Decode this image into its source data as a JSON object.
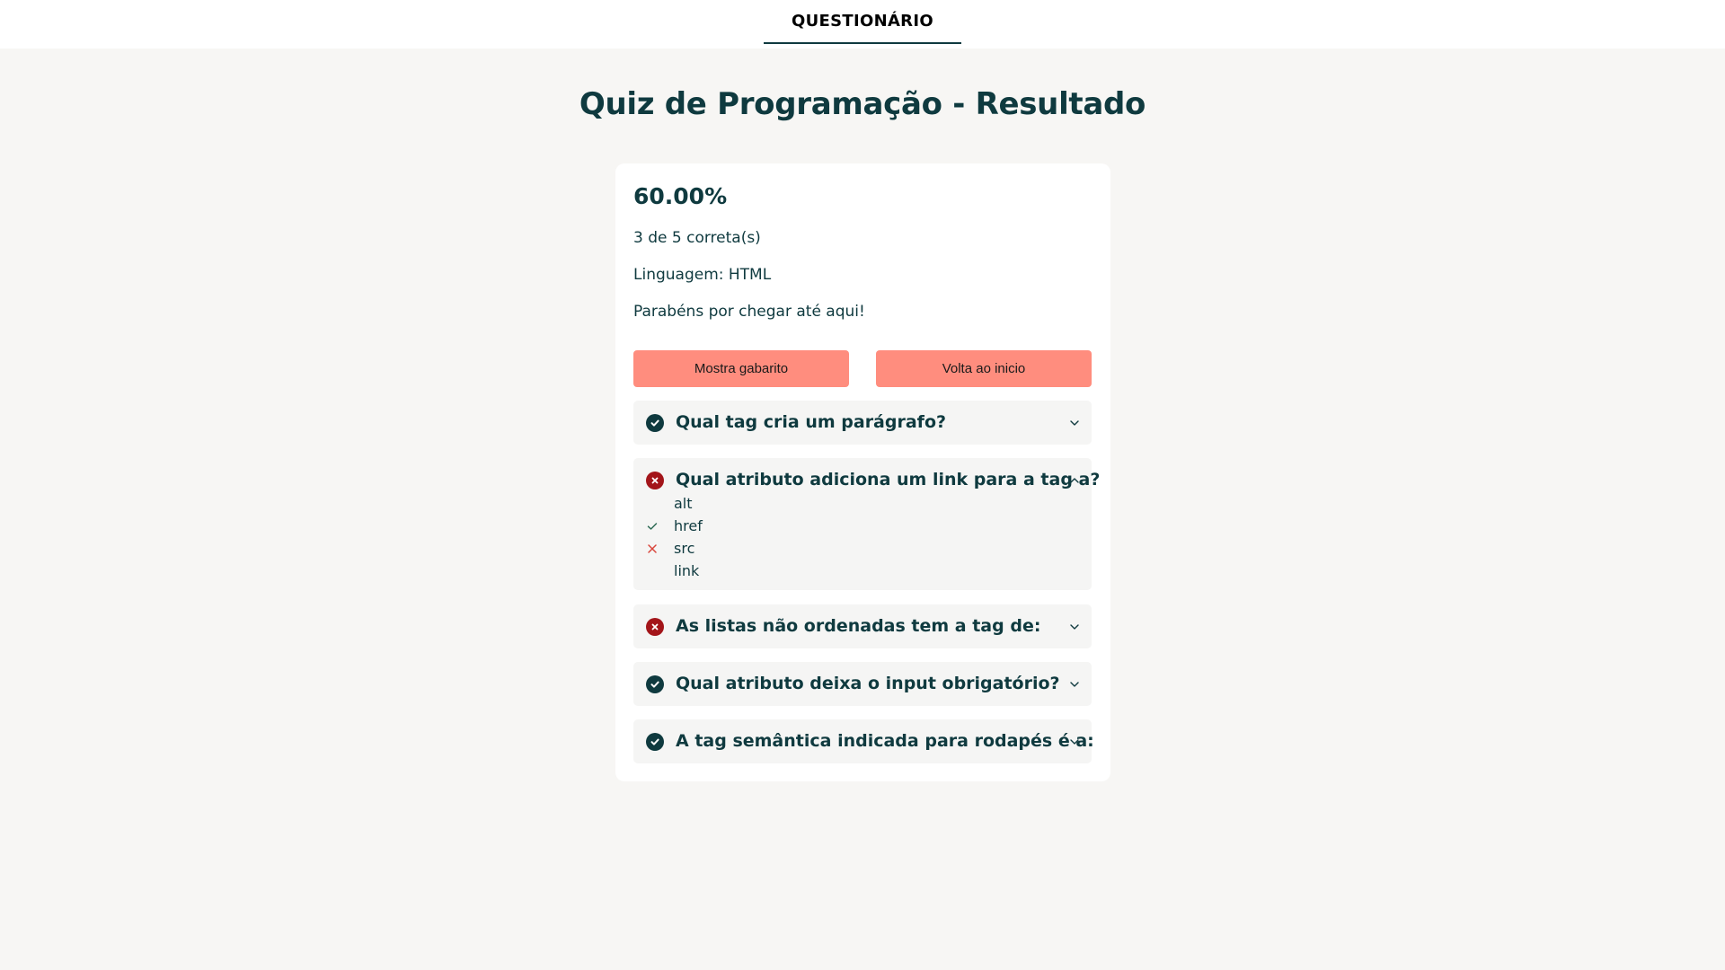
{
  "nav": {
    "tab_label": "QUESTIONÁRIO"
  },
  "page": {
    "title": "Quiz de Programação - Resultado"
  },
  "result": {
    "score": "60.00%",
    "correct_summary": "3 de 5 correta(s)",
    "language": "Linguagem: HTML",
    "message": "Parabéns por chegar até aqui!"
  },
  "buttons": {
    "show_answers": "Mostra gabarito",
    "back_to_start": "Volta ao inicio"
  },
  "questions": [
    {
      "title": "Qual tag cria um parágrafo?",
      "status": "correct",
      "expanded": false
    },
    {
      "title": "Qual atributo adiciona um link para a tag a?",
      "status": "incorrect",
      "expanded": true,
      "options": [
        {
          "label": "alt",
          "mark": "none"
        },
        {
          "label": "href",
          "mark": "correct"
        },
        {
          "label": "src",
          "mark": "wrong"
        },
        {
          "label": "link",
          "mark": "none"
        }
      ]
    },
    {
      "title": "As listas não ordenadas tem a tag de:",
      "status": "incorrect",
      "expanded": false
    },
    {
      "title": "Qual atributo deixa o input obrigatório?",
      "status": "correct",
      "expanded": false
    },
    {
      "title": "A tag semântica indicada para rodapés é a:",
      "status": "correct",
      "expanded": false
    }
  ],
  "colors": {
    "primary": "#0f3a3f",
    "accent_button": "#ff8d7e",
    "error": "#a3151a",
    "background": "#f7f6f4"
  },
  "icons": {
    "correct": "check-circle-icon",
    "incorrect": "x-circle-icon",
    "collapsed": "chevron-down-icon",
    "expanded": "chevron-up-icon"
  }
}
